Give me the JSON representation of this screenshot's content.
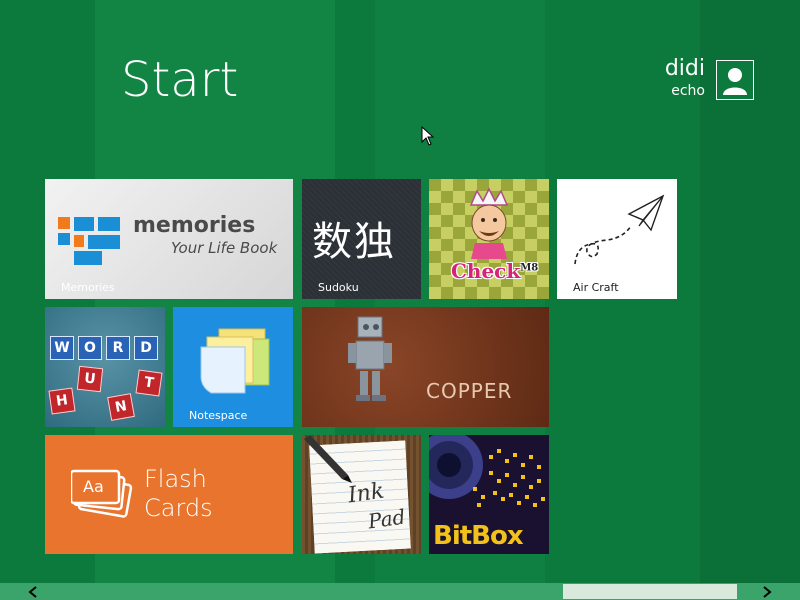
{
  "screen": {
    "title": "Start"
  },
  "user": {
    "name": "didi",
    "subtitle": "echo",
    "icon": "user-avatar-icon"
  },
  "colors": {
    "background": "#0c7a3c",
    "tile_orange": "#e8742e",
    "tile_blue": "#1e8ee0",
    "tile_brown": "#7a3a1f",
    "tile_dark": "#2c3238",
    "scrollbar": "#3aa46a"
  },
  "tiles": {
    "memories": {
      "label": "Memories",
      "logo_line1": "memories",
      "logo_line2": "Your Life Book"
    },
    "sudoku": {
      "label": "Sudoku",
      "glyphs": "数独"
    },
    "checkm8": {
      "logo": "Check",
      "logo_sup": "M8"
    },
    "aircraft": {
      "label": "Air Craft"
    },
    "wordhunt": {
      "row1": [
        "W",
        "O",
        "R",
        "D"
      ],
      "row2": [
        "H",
        "U",
        "N",
        "T"
      ]
    },
    "notespace": {
      "label": "Notespace"
    },
    "copper": {
      "text": "COPPER"
    },
    "flashcards": {
      "line1": "Flash",
      "line2": "Cards",
      "icon_text": "Aa"
    },
    "inkpad": {
      "line1": "Ink",
      "line2": "Pad"
    },
    "bitbox": {
      "text": "BitBox"
    }
  },
  "scrollbar": {
    "left_icon": "chevron-left-icon",
    "right_icon": "chevron-right-icon"
  }
}
